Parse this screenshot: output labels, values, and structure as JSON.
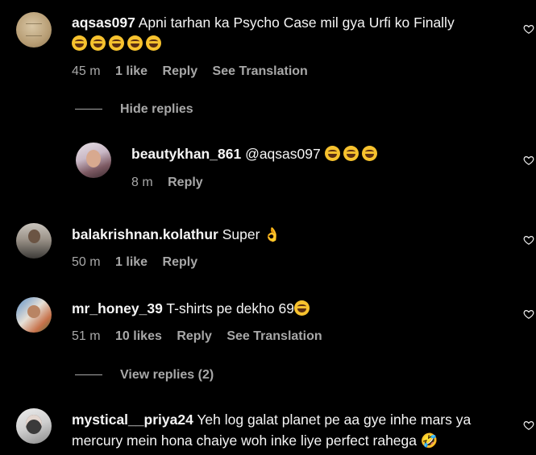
{
  "comments": [
    {
      "username": "aqsas097",
      "text": "Apni tarhan ka Psycho Case mil gya Urfi ko Finally",
      "emoji_line": "😂😂😂😂😂",
      "time": "45 m",
      "likes": "1 like",
      "reply": "Reply",
      "translation": "See Translation",
      "toggle": "Hide replies"
    },
    {
      "username": "beautykhan_861",
      "text": "@aqsas097",
      "emoji": "😂😂😂",
      "time": "8 m",
      "reply": "Reply"
    },
    {
      "username": "balakrishnan.kolathur",
      "text": "Super",
      "emoji": "👌",
      "time": "50 m",
      "likes": "1 like",
      "reply": "Reply"
    },
    {
      "username": "mr_honey_39",
      "text": "T-shirts pe dekho 69",
      "emoji": "😂",
      "time": "51 m",
      "likes": "10 likes",
      "reply": "Reply",
      "translation": "See Translation",
      "toggle": "View replies (2)"
    },
    {
      "username": "mystical__priya24",
      "text": "Yeh log galat planet pe aa gye inhe mars ya",
      "text_line2": "mercury mein hona chaiye woh inke liye perfect rahega",
      "emoji": "🤣"
    }
  ]
}
